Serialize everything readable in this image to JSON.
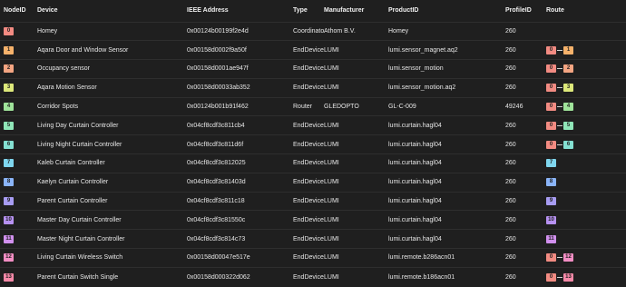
{
  "headers": {
    "node_id": "NodeID",
    "device": "Device",
    "ieee": "IEEE Address",
    "type": "Type",
    "manufacturer": "Manufacturer",
    "product_id": "ProductID",
    "profile_id": "ProfileID",
    "route": "Route"
  },
  "badge_colors": {
    "0": "#f28b82",
    "1": "#f6b26b",
    "2": "#f4a582",
    "3": "#dde87a",
    "4": "#9fe39a",
    "5": "#8fe6b8",
    "6": "#84e0d2",
    "7": "#7fd6ee",
    "8": "#8ab4f8",
    "9": "#a79cf2",
    "10": "#b691f0",
    "11": "#d190ee",
    "12": "#f38ec4",
    "13": "#f589a8"
  },
  "rows": [
    {
      "node_id": "0",
      "device": "Homey",
      "ieee": "0x00124b00199f2e4d",
      "type": "Coordinator",
      "manufacturer": "Athom B.V.",
      "product_id": "Homey",
      "profile_id": "260",
      "route": []
    },
    {
      "node_id": "1",
      "device": "Aqara Door and Window Sensor",
      "ieee": "0x00158d0002f9a50f",
      "type": "EndDevice",
      "manufacturer": "LUMI",
      "product_id": "lumi.sensor_magnet.aq2",
      "profile_id": "260",
      "route": [
        "0",
        "1"
      ]
    },
    {
      "node_id": "2",
      "device": "Occupancy sensor",
      "ieee": "0x00158d0001ae947f",
      "type": "EndDevice",
      "manufacturer": "LUMI",
      "product_id": "lumi.sensor_motion",
      "profile_id": "260",
      "route": [
        "0",
        "2"
      ]
    },
    {
      "node_id": "3",
      "device": "Aqara Motion Sensor",
      "ieee": "0x00158d00033ab352",
      "type": "EndDevice",
      "manufacturer": "LUMI",
      "product_id": "lumi.sensor_motion.aq2",
      "profile_id": "260",
      "route": [
        "0",
        "3"
      ]
    },
    {
      "node_id": "4",
      "device": "Corridor Spots",
      "ieee": "0x00124b001b91f462",
      "type": "Router",
      "manufacturer": "GLEDOPTO",
      "product_id": "GL-C-009",
      "profile_id": "49246",
      "route": [
        "0",
        "4"
      ]
    },
    {
      "node_id": "5",
      "device": "Living Day Curtain Controller",
      "ieee": "0x04cf8cdf3c811cb4",
      "type": "EndDevice",
      "manufacturer": "LUMI",
      "product_id": "lumi.curtain.hagl04",
      "profile_id": "260",
      "route": [
        "0",
        "5"
      ]
    },
    {
      "node_id": "6",
      "device": "Living Night Curtain Controller",
      "ieee": "0x04cf8cdf3c811d6f",
      "type": "EndDevice",
      "manufacturer": "LUMI",
      "product_id": "lumi.curtain.hagl04",
      "profile_id": "260",
      "route": [
        "0",
        "6"
      ]
    },
    {
      "node_id": "7",
      "device": "Kaleb Curtain Controller",
      "ieee": "0x04cf8cdf3c812025",
      "type": "EndDevice",
      "manufacturer": "LUMI",
      "product_id": "lumi.curtain.hagl04",
      "profile_id": "260",
      "route": [
        "7"
      ]
    },
    {
      "node_id": "8",
      "device": "Kaelyn Curtain Controller",
      "ieee": "0x04cf8cdf3c81403d",
      "type": "EndDevice",
      "manufacturer": "LUMI",
      "product_id": "lumi.curtain.hagl04",
      "profile_id": "260",
      "route": [
        "8"
      ]
    },
    {
      "node_id": "9",
      "device": "Parent Curtain Controller",
      "ieee": "0x04cf8cdf3c811c18",
      "type": "EndDevice",
      "manufacturer": "LUMI",
      "product_id": "lumi.curtain.hagl04",
      "profile_id": "260",
      "route": [
        "9"
      ]
    },
    {
      "node_id": "10",
      "device": "Master Day Curtain Controller",
      "ieee": "0x04cf8cdf3c81550c",
      "type": "EndDevice",
      "manufacturer": "LUMI",
      "product_id": "lumi.curtain.hagl04",
      "profile_id": "260",
      "route": [
        "10"
      ]
    },
    {
      "node_id": "11",
      "device": "Master Night Curtain Controller",
      "ieee": "0x04cf8cdf3c814c73",
      "type": "EndDevice",
      "manufacturer": "LUMI",
      "product_id": "lumi.curtain.hagl04",
      "profile_id": "260",
      "route": [
        "11"
      ]
    },
    {
      "node_id": "12",
      "device": "Living Curtain Wireless Switch",
      "ieee": "0x00158d00047e517e",
      "type": "EndDevice",
      "manufacturer": "LUMI",
      "product_id": "lumi.remote.b286acn01",
      "profile_id": "260",
      "route": [
        "0",
        "12"
      ]
    },
    {
      "node_id": "13",
      "device": "Parent Curtain Switch Single",
      "ieee": "0x00158d000322d062",
      "type": "EndDevice",
      "manufacturer": "LUMI",
      "product_id": "lumi.remote.b186acn01",
      "profile_id": "260",
      "route": [
        "0",
        "13"
      ]
    }
  ]
}
